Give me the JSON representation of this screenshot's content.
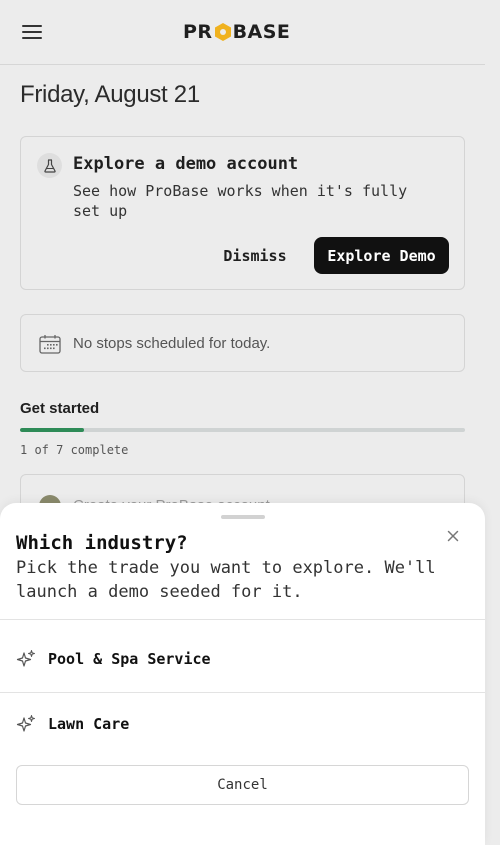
{
  "header": {
    "logo_left": "PR",
    "logo_right": "BASE",
    "menu_icon": "hamburger-menu-icon"
  },
  "date": "Friday, August 21",
  "demo_card": {
    "title": "Explore a demo account",
    "description": "See how ProBase works when it's fully set up",
    "dismiss_label": "Dismiss",
    "explore_label": "Explore Demo",
    "icon": "flask-icon"
  },
  "stops": {
    "text": "No stops scheduled for today.",
    "icon": "calendar-icon"
  },
  "get_started": {
    "title": "Get started",
    "progress_fraction": 0.1428,
    "progress_text": "1 of 7 complete",
    "first_task": "Create your ProBase account"
  },
  "sheet": {
    "title": "Which industry?",
    "description": "Pick the trade you want to explore. We'll launch a demo seeded for it.",
    "options": [
      {
        "label": "Pool & Spa Service",
        "icon": "sparkles-icon"
      },
      {
        "label": "Lawn Care",
        "icon": "sparkles-icon"
      }
    ],
    "cancel_label": "Cancel",
    "close_icon": "close-icon"
  },
  "colors": {
    "progress_fill": "#2e8b57",
    "logo_accent": "#f0b21f",
    "primary_button": "#111111"
  }
}
